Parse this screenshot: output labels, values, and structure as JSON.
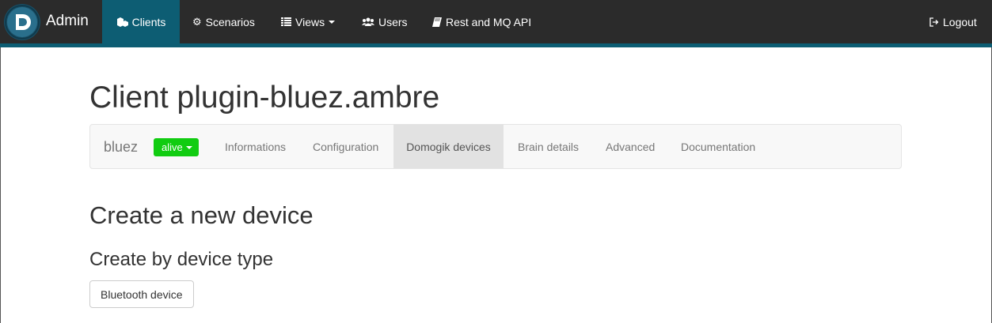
{
  "navbar": {
    "brand": "Admin",
    "logo_icon": "domogik-logo-icon",
    "items": [
      {
        "label": "Clients",
        "icon": "cubes-icon",
        "active": true
      },
      {
        "label": "Scenarios",
        "icon": "gear-icon",
        "active": false
      },
      {
        "label": "Views",
        "icon": "list-icon",
        "active": false,
        "dropdown": true
      },
      {
        "label": "Users",
        "icon": "users-icon",
        "active": false
      },
      {
        "label": "Rest and MQ API",
        "icon": "book-icon",
        "active": false
      }
    ],
    "logout": {
      "label": "Logout",
      "icon": "logout-icon"
    },
    "colors": {
      "bar": "#2b2b2b",
      "accent": "#0d5d73"
    }
  },
  "page": {
    "title": "Client plugin-bluez.ambre"
  },
  "subnav": {
    "brand": "bluez",
    "status": "alive",
    "status_color": "#11cc11",
    "items": [
      {
        "label": "Informations",
        "active": false
      },
      {
        "label": "Configuration",
        "active": false
      },
      {
        "label": "Domogik devices",
        "active": true
      },
      {
        "label": "Brain details",
        "active": false
      },
      {
        "label": "Advanced",
        "active": false
      },
      {
        "label": "Documentation",
        "active": false
      }
    ]
  },
  "content": {
    "heading": "Create a new device",
    "subheading": "Create by device type",
    "device_type_button": "Bluetooth device"
  }
}
